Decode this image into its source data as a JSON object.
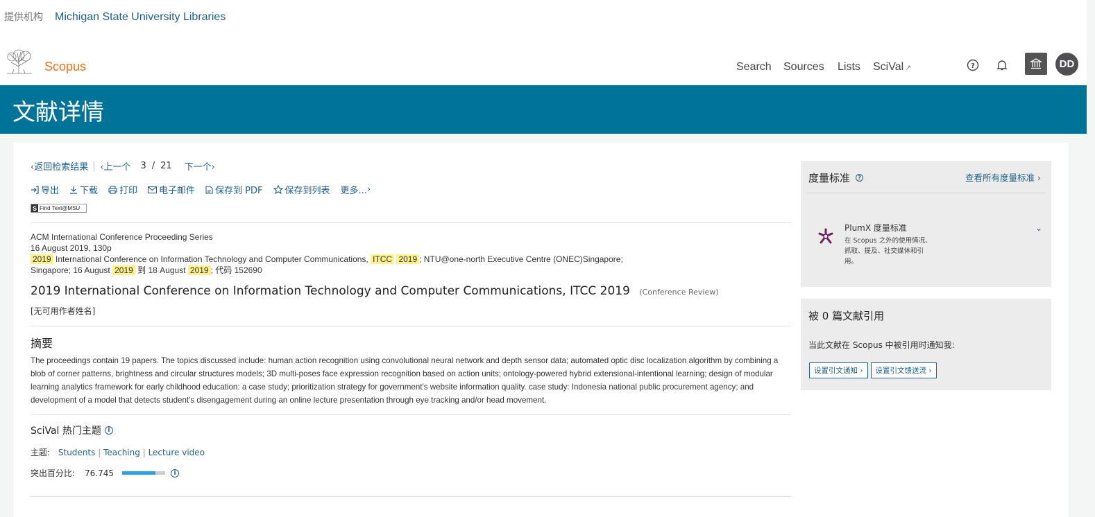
{
  "header": {
    "institution_label": "提供机构",
    "institution_name": "Michigan State University Libraries",
    "brand": "Scopus",
    "nav": {
      "search": "Search",
      "sources": "Sources",
      "lists": "Lists",
      "scival": "SciVal"
    },
    "avatar_initials": "DD"
  },
  "title_bar": {
    "title": "文献详情"
  },
  "pager": {
    "back": "返回检索结果",
    "prev": "上一个",
    "current": "3",
    "slash": "/",
    "total": "21",
    "next": "下一个"
  },
  "toolbar": {
    "export": "导出",
    "download": "下载",
    "print": "打印",
    "email": "电子邮件",
    "save_pdf": "保存到 PDF",
    "save_list": "保存到列表",
    "more": "更多..."
  },
  "findtext": {
    "label": "Find Text@MSU"
  },
  "meta": {
    "series": "ACM International Conference Proceeding Series",
    "date_pages": "16 August 2019, 130p",
    "year1": "2019",
    "conf_name": "International Conference on Information Technology and Computer Communications,",
    "acronym": "ITCC",
    "year2": "2019",
    "venue": "; NTU@one-north Executive Centre (ONEC)Singapore;",
    "loc_start": "Singapore; 16 August",
    "year3": "2019",
    "to": "到 18 August",
    "year4": "2019",
    "code": "; 代码 152690"
  },
  "document": {
    "title": "2019 International Conference on Information Technology and Computer Communications, ITCC 2019",
    "type": "(Conference Review)",
    "authors": "[无可用作者姓名]"
  },
  "abstract": {
    "heading": "摘要",
    "text": "The proceedings contain 19 papers. The topics discussed include: human action recognition using convolutional neural network and depth sensor data; automated optic disc localization algorithm by combining a blob of corner patterns, brightness and circular structures models; 3D multi-poses face expression recognition based on action units; ontology-powered hybrid extensional-intentional learning; design of modular learning analytics framework for early childhood education: a case study; prioritization strategy for government's website information quality. case study: Indonesia national public procurement agency; and development of a model that detects student's disengagement during an online lecture presentation through eye tracking and/or head movement."
  },
  "scival": {
    "heading": "SciVal 热门主题",
    "topic_label": "主题:",
    "topics": [
      "Students",
      "Teaching",
      "Lecture video"
    ],
    "percentile_label": "突出百分比:",
    "percentile": "76.745",
    "percentile_fraction": 0.767
  },
  "metrics": {
    "heading": "度量标准",
    "view_all": "查看所有度量标准",
    "plumx_title": "PlumX 度量标准",
    "plumx_desc": [
      "在 Scopus 之外的使用情况、",
      "抓取、提及、社交媒体和引",
      "用。"
    ]
  },
  "citations": {
    "heading": "被 0 篇文献引用",
    "notify_text": "当此文献在 Scopus 中被引用时通知我:",
    "set_alert": "设置引文通知",
    "set_feed": "设置引文馈送流"
  },
  "colors": {
    "header_blue": "#007398",
    "link": "#1f5f89",
    "brand_orange": "#e9711c",
    "highlight": "#fcf18b",
    "plumx_purple": "#6b1f5f"
  }
}
